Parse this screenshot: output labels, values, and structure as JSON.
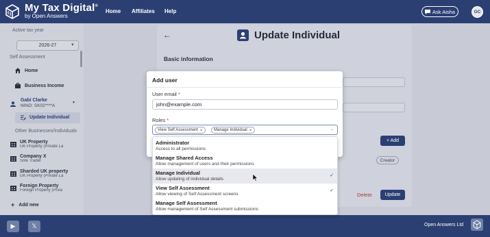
{
  "header": {
    "brand_title": "My Tax Digital",
    "brand_trademark": "®",
    "brand_subtitle": "by Open Answers",
    "nav": [
      "Home",
      "Affiliates",
      "Help"
    ],
    "ask_button": "Ask Aisha",
    "avatar_initials": "GC"
  },
  "sidebar": {
    "tax_year_label": "Active tax year",
    "tax_year_value": "2026-27",
    "self_assessment_heading": "Self Assessment",
    "items": [
      {
        "label": "Home",
        "icon": "home-icon"
      },
      {
        "label": "Business Income",
        "icon": "briefcase-icon"
      }
    ],
    "user_name": "Gabi Clarke",
    "user_nino": "NINO: SK02****A",
    "active_item": "Update Individual",
    "other_heading": "Other Businesses/Individuals",
    "properties": [
      {
        "title": "UK Property",
        "subtitle": "UK Property (Private La"
      },
      {
        "title": "Company X",
        "subtitle": "Sole Trader"
      },
      {
        "title": "Sharded UK property",
        "subtitle": "UK Property (Private La"
      },
      {
        "title": "Foreign Property",
        "subtitle": "Foreign Property (Priva"
      }
    ],
    "add_new": "Add new"
  },
  "main": {
    "page_title": "Update Individual",
    "section_title": "Basic information",
    "add_button": "+ Add",
    "creator_badge": "Creator",
    "delete_label": "Delete",
    "update_label": "Update"
  },
  "modal": {
    "title": "Add user",
    "email_label": "User email",
    "email_value": "john@example.com",
    "roles_label": "Roles",
    "required_mark": "*",
    "selected_roles": [
      "View Self Assessment",
      "Manage Individual"
    ],
    "options": [
      {
        "title": "Administrator",
        "description": "Access to all permissions",
        "checked": false,
        "highlighted": false
      },
      {
        "title": "Manage Shared Access",
        "description": "Allow management of users and their permissions",
        "checked": false,
        "highlighted": false
      },
      {
        "title": "Manage Individual",
        "description": "Allow updating of individual details",
        "checked": true,
        "highlighted": true
      },
      {
        "title": "View Self Assessment",
        "description": "Allow viewing of Self Assessment screens",
        "checked": true,
        "highlighted": false
      },
      {
        "title": "Manage Self Assessment",
        "description": "Allow management of Self Assessment submissions",
        "checked": false,
        "highlighted": false
      }
    ],
    "check_glyph": "✓",
    "chip_remove_glyph": "×"
  },
  "footer": {
    "company": "Open Answers Ltd"
  },
  "colors": {
    "brand": "#2b3f73",
    "highlight": "#e8e9ee",
    "danger": "#a83a3a"
  }
}
